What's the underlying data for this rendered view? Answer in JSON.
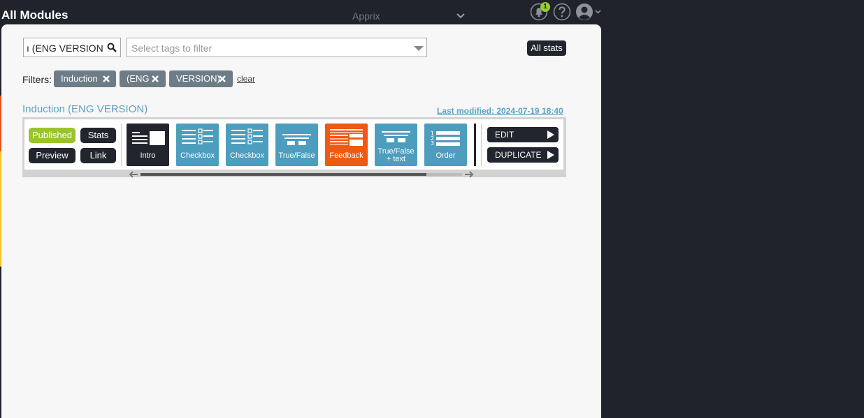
{
  "header": {
    "title": "All Modules",
    "org_name": "Apprix",
    "notification_count": "1",
    "icons": [
      "bell-icon",
      "help-icon",
      "user-icon",
      "chevron-down-icon"
    ]
  },
  "search": {
    "value": "ı (ENG VERSION)",
    "tags_placeholder": "Select tags to filter"
  },
  "toolbar": {
    "all_stats_label": "All stats"
  },
  "filters": {
    "label": "Filters:",
    "chips": [
      "Induction",
      "(ENG",
      "VERSION)"
    ],
    "clear_label": "clear"
  },
  "module": {
    "title": "Induction (ENG VERSION)",
    "last_modified": "Last modified: 2024-07-19 18:40",
    "buttons": {
      "published": "Published",
      "stats": "Stats",
      "preview": "Preview",
      "link": "Link",
      "edit": "EDIT",
      "duplicate": "DUPLICATE"
    },
    "steps": [
      {
        "label": "Intro",
        "type": "intro-icon"
      },
      {
        "label": "Checkbox",
        "type": "checkbox-icon"
      },
      {
        "label": "Checkbox",
        "type": "checkbox-icon"
      },
      {
        "label": "True/False",
        "type": "true-false-icon"
      },
      {
        "label": "Feedback",
        "type": "feedback-icon"
      },
      {
        "label": "True/False\n+ text",
        "label_line1": "True/False",
        "label_line2": "+ text",
        "type": "true-false-text-icon"
      },
      {
        "label": "Order",
        "type": "order-icon"
      }
    ]
  },
  "colors": {
    "published": "#9ac42c",
    "step_blue": "#4d9dbf",
    "step_dark": "#22252d",
    "step_orange": "#ee5a12",
    "chip": "#6d7c87",
    "link": "#5aa2c4",
    "strip_orange": "#e8541a",
    "strip_yellow": "#f3c623"
  }
}
